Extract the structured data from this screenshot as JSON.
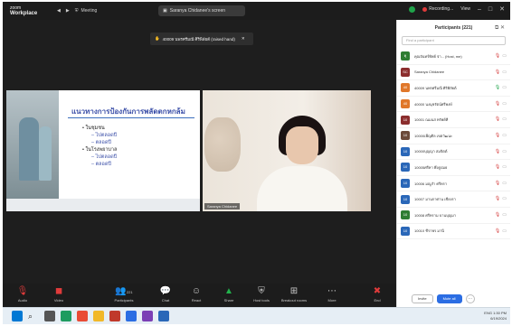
{
  "app": {
    "brand_top": "zoom",
    "brand_bottom": "Workplace",
    "menu": "Meeting"
  },
  "title_chip": {
    "text": "Saranya Chidanee's screen"
  },
  "titlebar_right": {
    "recording": "Recording...",
    "view": "View"
  },
  "banner": {
    "text": "40009 นพรศรีมณี ศิริพิลัยต์ (raised hand)"
  },
  "slide": {
    "title": "แนวทางการป้องกันการพลัดตกหกล้ม",
    "bullets": [
      {
        "label": "• ในชุมชน",
        "subs": [
          "– ไปตลอดปี",
          "– ตลอดปี"
        ]
      },
      {
        "label": "• ในโรงพยาบาล",
        "subs": [
          "– ไปตลอดปี",
          "– ตลอดปี"
        ]
      }
    ]
  },
  "camera": {
    "name": "Saranya Chidanee"
  },
  "toolbar": {
    "audio": "Audio",
    "video": "Video",
    "participants": "Participants",
    "participants_count": "221",
    "chat": "Chat",
    "react": "React",
    "share": "Share",
    "host_tools": "Host tools",
    "breakout": "Breakout rooms",
    "more": "More",
    "end": "End"
  },
  "panel": {
    "title": "Participants (221)",
    "search_placeholder": "Find a participant",
    "participants": [
      {
        "initials": "คุ",
        "name": "คุณจันทร์ทิพย์ จ่า... (Host, me)",
        "color": "#2e7d32"
      },
      {
        "initials": "SC",
        "name": "Saranya Chidanee",
        "color": "#8b2d2d"
      },
      {
        "initials": "40",
        "name": "40009 นพรศรีมณี ศิริพิลัยต์",
        "color": "#e0772a"
      },
      {
        "initials": "40",
        "name": "40000 นงนุชรัตน์ศรีพงษ์",
        "color": "#e0772a"
      },
      {
        "initials": "10",
        "name": "10001 ณมนส ทรัพย์ที",
        "color": "#8b2d2d"
      },
      {
        "initials": "10",
        "name": "10000เพ็ญศิล เขตวัฒนะ",
        "color": "#6b4a3a"
      },
      {
        "initials": "10",
        "name": "10000บุญญา สมจิตต์",
        "color": "#2a67b8"
      },
      {
        "initials": "10",
        "name": "10005ศรีทา พึ่งธูปมธ",
        "color": "#2a67b8"
      },
      {
        "initials": "10",
        "name": "10006 มณูกำ ศรีทรา",
        "color": "#2a67b8"
      },
      {
        "initials": "10",
        "name": "10007 มานกาศาน เชียงรา",
        "color": "#2a67b8"
      },
      {
        "initials": "10",
        "name": "10008 ศรีทราม บานบุญมา",
        "color": "#2e7d32"
      },
      {
        "initials": "10",
        "name": "10010 ชีราพร มานี",
        "color": "#2a67b8"
      }
    ],
    "invite": "Invite",
    "mute_all": "Mute all"
  },
  "taskbar": {
    "time": "1:30 PM",
    "date": "6/19/2024",
    "lang": "ENG"
  }
}
